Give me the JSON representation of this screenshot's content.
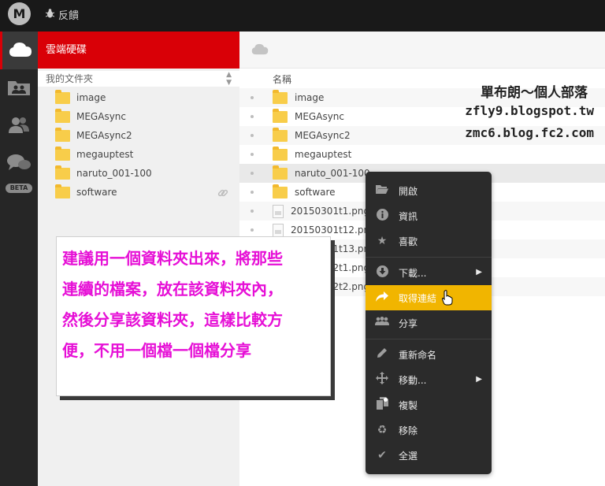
{
  "topbar": {
    "logo_text": "M",
    "feedback_label": "反饋"
  },
  "leftbar": {
    "beta_label": "BETA"
  },
  "tree": {
    "header_title": "雲端硬碟",
    "sort_label": "我的文件夾",
    "folders": [
      "image",
      "MEGAsync",
      "MEGAsync2",
      "megauptest",
      "naruto_001-100",
      "software"
    ]
  },
  "main": {
    "column_name_header": "名稱",
    "rows": [
      {
        "name": "image",
        "type": "folder"
      },
      {
        "name": "MEGAsync",
        "type": "folder"
      },
      {
        "name": "MEGAsync2",
        "type": "folder"
      },
      {
        "name": "megauptest",
        "type": "folder"
      },
      {
        "name": "naruto_001-100",
        "type": "folder"
      },
      {
        "name": "software",
        "type": "folder"
      },
      {
        "name": "20150301t1.png",
        "type": "file"
      },
      {
        "name": "20150301t12.png",
        "type": "file"
      },
      {
        "name": "20150301t13.png",
        "type": "file"
      },
      {
        "name": "20141022t1.png",
        "type": "file"
      },
      {
        "name": "20141022t2.png",
        "type": "file"
      }
    ]
  },
  "watermark": {
    "line1": "單布朗～個人部落",
    "line2": "zfly9.blogspot.tw",
    "line3": "zmc6.blog.fc2.com"
  },
  "context_menu": {
    "items": [
      {
        "label": "開啟",
        "icon": "folder-open-icon"
      },
      {
        "label": "資訊",
        "icon": "info-icon"
      },
      {
        "label": "喜歡",
        "icon": "star-icon"
      },
      {
        "label": "下載...",
        "icon": "download-icon"
      },
      {
        "label": "取得連結",
        "icon": "share-link-icon"
      },
      {
        "label": "分享",
        "icon": "users-icon"
      },
      {
        "label": "重新命名",
        "icon": "pencil-icon"
      },
      {
        "label": "移動...",
        "icon": "move-icon"
      },
      {
        "label": "複製",
        "icon": "copy-icon"
      },
      {
        "label": "移除",
        "icon": "recycle-icon"
      },
      {
        "label": "全選",
        "icon": "check-icon"
      }
    ],
    "active_color": "#f1b500"
  },
  "annotation": {
    "lines": [
      "建議用一個資料夾出來，將那些",
      "連續的檔案，放在該資料夾內，",
      "然後分享該資料夾，這樣比較方",
      "便，不用一個檔一個檔分享"
    ],
    "text_color": "#e60fd6"
  },
  "colors": {
    "brand_red": "#d90007",
    "folder_yellow": "#f8cd4a",
    "dark_bg": "#191919"
  }
}
